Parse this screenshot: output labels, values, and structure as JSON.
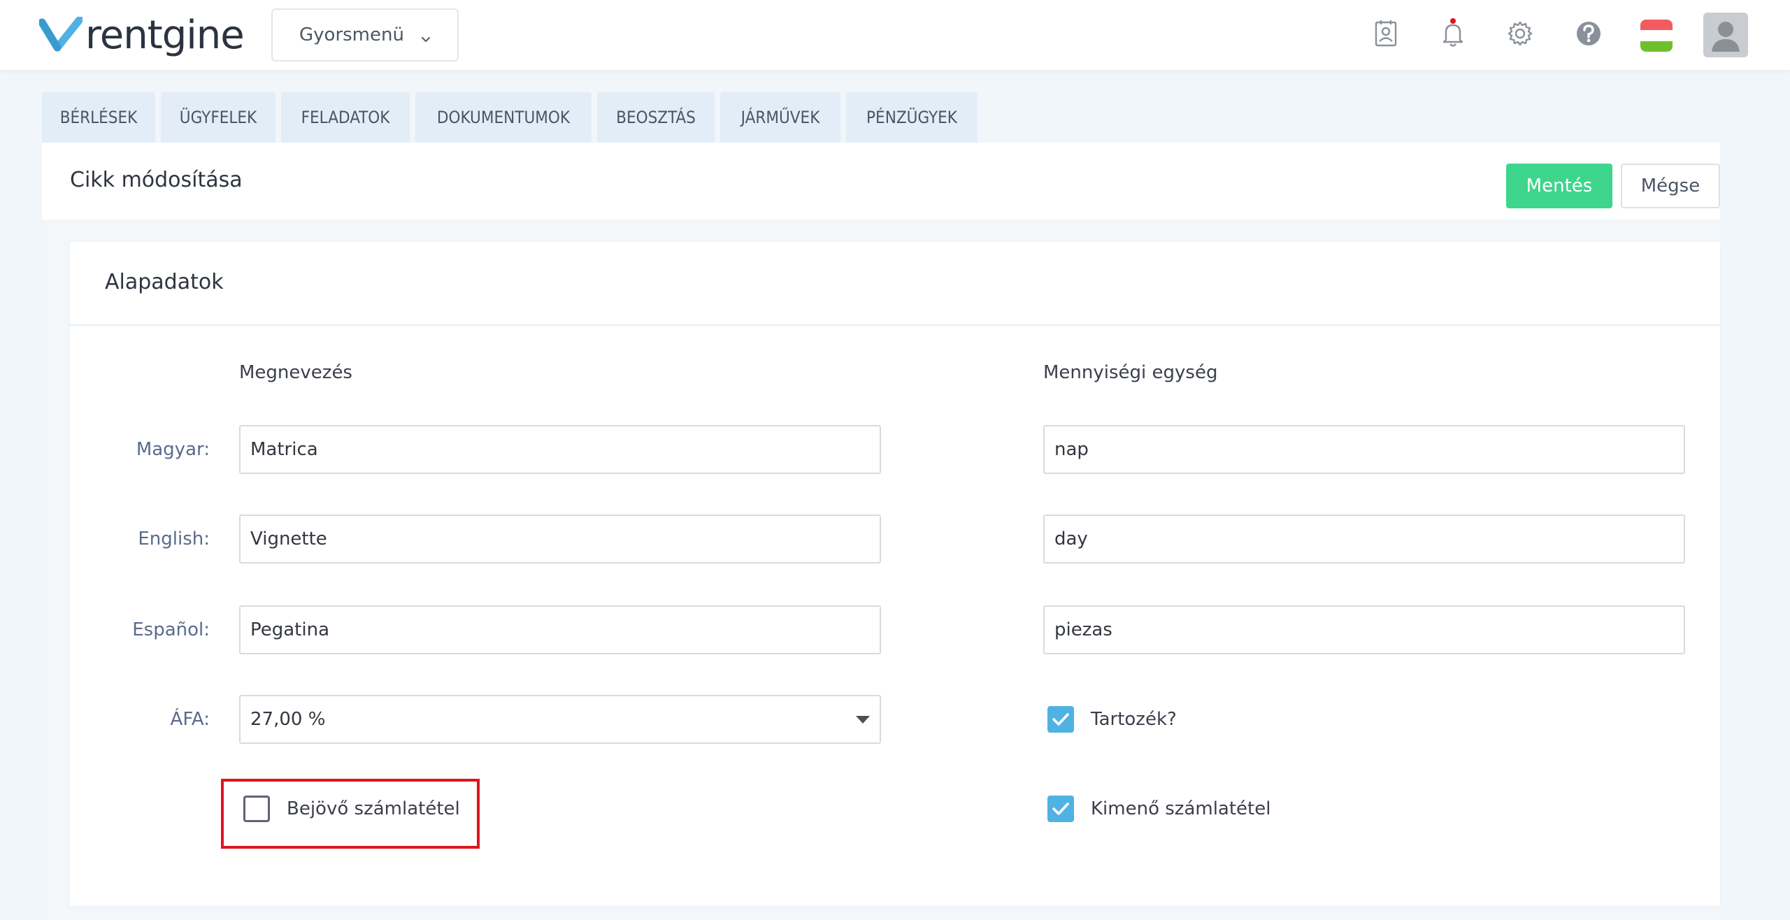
{
  "app": {
    "logo_text": "rentgine",
    "brand_color": "#4fb2e3"
  },
  "topbar": {
    "quick_menu_label": "Gyorsmenü",
    "icons": [
      "contacts-icon",
      "bell-icon",
      "gear-icon",
      "help-icon"
    ],
    "notification_dot_color": "#e0141e",
    "language_flag": "hungarian-flag"
  },
  "tabs": [
    {
      "label": "BÉRLÉSEK"
    },
    {
      "label": "ÜGYFELEK"
    },
    {
      "label": "FELADATOK"
    },
    {
      "label": "DOKUMENTUMOK"
    },
    {
      "label": "BEOSZTÁS"
    },
    {
      "label": "JÁRMŰVEK"
    },
    {
      "label": "PÉNZÜGYEK"
    }
  ],
  "page": {
    "title": "Cikk módosítása",
    "save_label": "Mentés",
    "cancel_label": "Mégse",
    "save_color": "#3dd68c"
  },
  "panel": {
    "title": "Alapadatok",
    "col_name_header": "Megnevezés",
    "col_unit_header": "Mennyiségi egység",
    "rows": [
      {
        "label": "Magyar:",
        "name": "Matrica",
        "unit": "nap"
      },
      {
        "label": "English:",
        "name": "Vignette",
        "unit": "day"
      },
      {
        "label": "Español:",
        "name": "Pegatina",
        "unit": "piezas"
      }
    ],
    "vat": {
      "label": "ÁFA:",
      "value": "27,00 %"
    },
    "checkboxes": {
      "incoming": {
        "label": "Bejövő számlatétel",
        "checked": false
      },
      "accessory": {
        "label": "Tartozék?",
        "checked": true
      },
      "outgoing": {
        "label": "Kimenő számlatétel",
        "checked": true
      }
    }
  }
}
